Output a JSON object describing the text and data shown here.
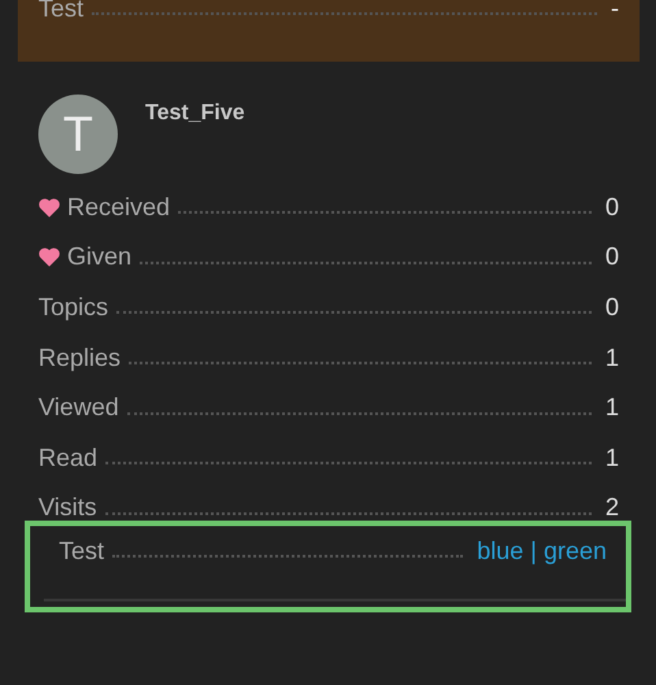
{
  "top_card": {
    "label": "Test",
    "value": "-"
  },
  "user": {
    "avatar_letter": "T",
    "username": "Test_Five"
  },
  "stats": [
    {
      "kind": "heart",
      "label": "Received",
      "value": "0"
    },
    {
      "kind": "heart",
      "label": "Given",
      "value": "0"
    },
    {
      "kind": "plain",
      "label": "Topics",
      "value": "0"
    },
    {
      "kind": "plain",
      "label": "Replies",
      "value": "1"
    },
    {
      "kind": "plain",
      "label": "Viewed",
      "value": "1"
    },
    {
      "kind": "plain",
      "label": "Read",
      "value": "1"
    },
    {
      "kind": "plain",
      "label": "Visits",
      "value": "2"
    }
  ],
  "custom_fields": [
    {
      "label": "Test",
      "value": "blue | green",
      "highlighted": true
    }
  ]
}
